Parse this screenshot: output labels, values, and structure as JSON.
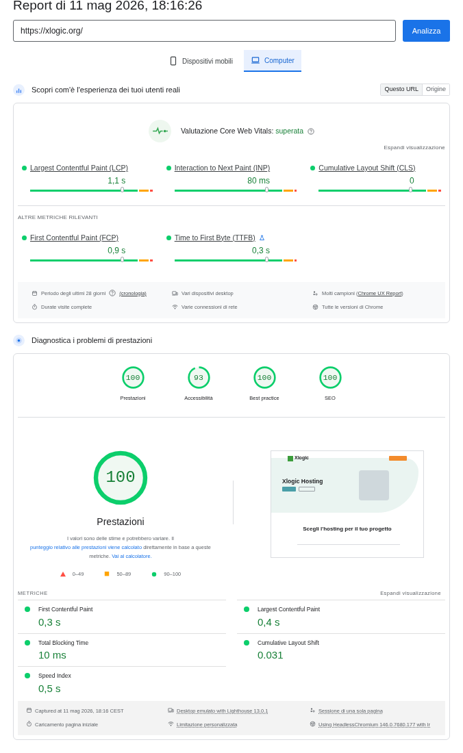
{
  "title": "Report di 11 mag 2026, 18:16:26",
  "url_field": {
    "value": "https://xlogic.org/"
  },
  "analyze_button": "Analizza",
  "device_tabs": [
    {
      "label": "Dispositivi mobili",
      "kind": "phone",
      "selected": false
    },
    {
      "label": "Computer",
      "kind": "laptop",
      "selected": true
    }
  ],
  "field_section": {
    "title": "Scopri com'è l'esperienza dei tuoi utenti reali",
    "scope_toggle": [
      {
        "label": "Questo URL",
        "selected": true
      },
      {
        "label": "Origine",
        "selected": false
      }
    ],
    "assessment_label": "Valutazione Core Web Vitals:",
    "assessment_result": "superata",
    "expand_link": "Espandi visualizzazione",
    "core_metrics": [
      {
        "name": "Largest Contentful Paint (LCP)",
        "value": "1,1 s",
        "level": 0.75
      },
      {
        "name": "Interaction to Next Paint (INP)",
        "value": "80 ms",
        "level": 0.75
      },
      {
        "name": "Cumulative Layout Shift (CLS)",
        "value": "0",
        "level": 0.75
      }
    ],
    "other_heading": "ALTRE METRICHE RILEVANTI",
    "other_metrics": [
      {
        "name": "First Contentful Paint (FCP)",
        "value": "0,9 s",
        "level": 0.75,
        "kind": "plain"
      },
      {
        "name": "Time to First Byte (TTFB)",
        "value": "0,3 s",
        "level": 0.75,
        "kind": "experimental"
      }
    ],
    "info": [
      {
        "kind": "calendar",
        "parts": [
          {
            "kind": "text",
            "text": "Periodo degli ultimi 28 giorni"
          },
          {
            "kind": "help"
          },
          {
            "kind": "link",
            "text": "(cronologia)"
          }
        ]
      },
      {
        "kind": "devices",
        "parts": [
          {
            "kind": "text",
            "text": "Vari dispositivi desktop"
          }
        ]
      },
      {
        "kind": "samples",
        "parts": [
          {
            "kind": "text",
            "text": "Molti campioni ("
          },
          {
            "kind": "link",
            "text": "Chrome UX Report"
          },
          {
            "kind": "text",
            "text": ")"
          }
        ]
      },
      {
        "kind": "timer",
        "parts": [
          {
            "kind": "text",
            "text": "Durate visite complete"
          }
        ]
      },
      {
        "kind": "wifi",
        "parts": [
          {
            "kind": "text",
            "text": "Varie connessioni di rete"
          }
        ]
      },
      {
        "kind": "chrome",
        "parts": [
          {
            "kind": "text",
            "text": "Tutte le versioni di Chrome"
          }
        ]
      }
    ]
  },
  "lab_section": {
    "title": "Diagnostica i problemi di prestazioni",
    "scores": [
      {
        "score": "100",
        "label": "Prestazioni",
        "level": 1
      },
      {
        "score": "93",
        "label": "Accessibilità",
        "level": 0.93
      },
      {
        "score": "100",
        "label": "Best practice",
        "level": 1
      },
      {
        "score": "100",
        "label": "SEO",
        "level": 1
      }
    ],
    "main_score": {
      "score": "100",
      "label": "Prestazioni",
      "level": 1
    },
    "description": [
      {
        "kind": "text",
        "text": "I valori sono delle stime e potrebbero variare. Il "
      },
      {
        "kind": "link",
        "text": "punteggio relativo alle prestazioni viene calcolato"
      },
      {
        "kind": "text",
        "text": " direttamente in base a queste metriche. "
      },
      {
        "kind": "link",
        "text": "Vai al calcolatore."
      }
    ],
    "legend": [
      {
        "kind": "triangle",
        "label": "0–49"
      },
      {
        "kind": "square",
        "label": "50–89"
      },
      {
        "kind": "circle",
        "label": "90–100"
      }
    ],
    "screenshot": {
      "logo": "Xlogic",
      "heading": "Xlogic Hosting",
      "section_title": "Scegli l'hosting per il tuo progetto"
    },
    "metrics_heading": "METRICHE",
    "expand_link": "Espandi visualizzazione",
    "metrics": [
      {
        "name": "First Contentful Paint",
        "value": "0,3 s"
      },
      {
        "name": "Largest Contentful Paint",
        "value": "0,4 s"
      },
      {
        "name": "Total Blocking Time",
        "value": "10 ms"
      },
      {
        "name": "Cumulative Layout Shift",
        "value": "0.031"
      },
      {
        "name": "Speed Index",
        "value": "0,5 s"
      }
    ],
    "info": [
      {
        "kind": "calendar",
        "text": "Captured at 11 mag 2026, 18:16 CEST",
        "link": false
      },
      {
        "kind": "devices",
        "text": "Desktop emulato with Lighthouse 13.0.1",
        "link": true
      },
      {
        "kind": "samples",
        "text": "Sessione di una sola pagina",
        "link": true
      },
      {
        "kind": "timer",
        "text": "Caricamento pagina iniziale",
        "link": false
      },
      {
        "kind": "wifi",
        "text": "Limitazione personalizzata",
        "link": true
      },
      {
        "kind": "chrome",
        "text": "Using HeadlessChromium 146.0.7680.177 with lr",
        "link": true
      }
    ]
  }
}
